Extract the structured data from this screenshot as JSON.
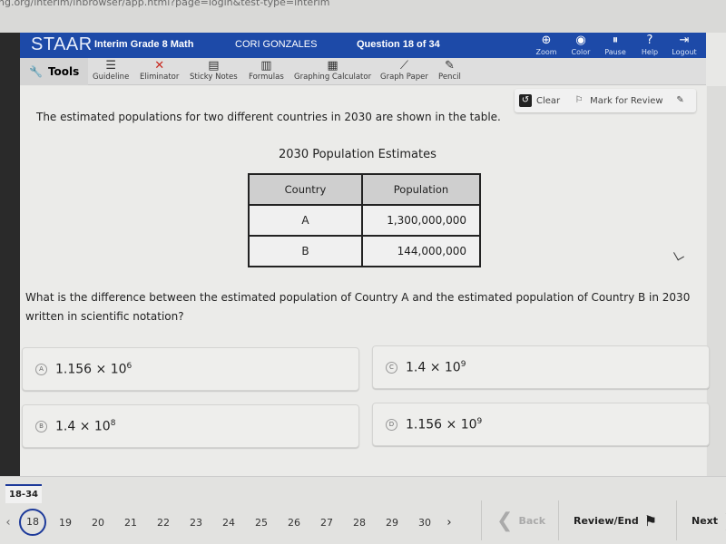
{
  "browser": {
    "url": "ng.org/interim/inbrowser/app.html?page=login&test-type=interim"
  },
  "header": {
    "logo": "STAAR",
    "test_name": "Interim Grade 8 Math",
    "student_name": "CORI GONZALES",
    "question_counter": "Question 18 of 34",
    "tools": [
      {
        "label": "Zoom",
        "icon": "zoom-icon"
      },
      {
        "label": "Color",
        "icon": "eye-icon"
      },
      {
        "label": "Pause",
        "icon": "pause-icon"
      },
      {
        "label": "Help",
        "icon": "help-icon"
      },
      {
        "label": "Logout",
        "icon": "logout-icon"
      }
    ]
  },
  "toolbar": {
    "label": "Tools",
    "tools": [
      {
        "label": "Guideline",
        "icon": "guideline-icon"
      },
      {
        "label": "Eliminator",
        "icon": "x-icon"
      },
      {
        "label": "Sticky Notes",
        "icon": "note-icon"
      },
      {
        "label": "Formulas",
        "icon": "books-icon"
      },
      {
        "label": "Graphing Calculator",
        "icon": "calculator-icon"
      },
      {
        "label": "Graph Paper",
        "icon": "graph-icon"
      },
      {
        "label": "Pencil",
        "icon": "pencil-icon"
      }
    ]
  },
  "actions": {
    "clear": "Clear",
    "mark_for_review": "Mark for Review"
  },
  "question": {
    "stem": "The estimated populations for two different countries in 2030 are shown in the table.",
    "table_title": "2030 Population Estimates",
    "table": {
      "headers": [
        "Country",
        "Population"
      ],
      "rows": [
        [
          "A",
          "1,300,000,000"
        ],
        [
          "B",
          "144,000,000"
        ]
      ]
    },
    "prompt": "What is the difference between the estimated population of Country A and the estimated population of Country B in 2030 written in scientific notation?",
    "choices": [
      {
        "letter": "A",
        "base": "1.156 × 10",
        "exp": "6"
      },
      {
        "letter": "B",
        "base": "1.4 × 10",
        "exp": "8"
      },
      {
        "letter": "C",
        "base": "1.4 × 10",
        "exp": "9"
      },
      {
        "letter": "D",
        "base": "1.156 × 10",
        "exp": "9"
      }
    ]
  },
  "navigation": {
    "range_tab": "18-34",
    "current_page": "18",
    "pages": [
      "19",
      "20",
      "21",
      "22",
      "23",
      "24",
      "25",
      "26",
      "27",
      "28",
      "29",
      "30"
    ],
    "back": "Back",
    "review_end": "Review/End",
    "next": "Next"
  }
}
